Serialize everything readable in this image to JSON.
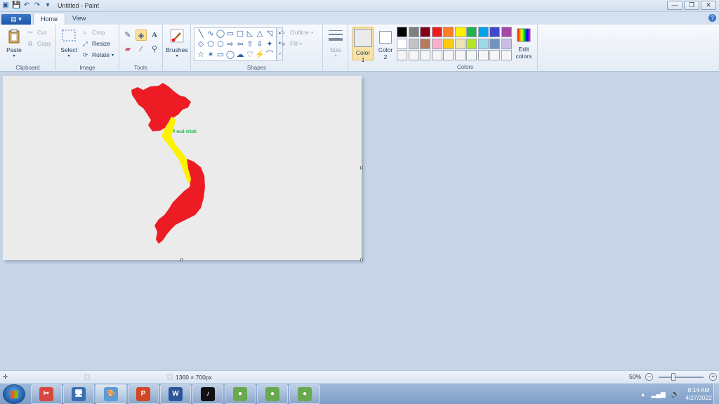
{
  "window": {
    "title": "Untitled - Paint",
    "minimize_glyph": "—",
    "restore_glyph": "❐",
    "close_glyph": "✕"
  },
  "tabs": {
    "file_glyph": "▤ ▾",
    "items": [
      "Home",
      "View"
    ],
    "help_glyph": "?"
  },
  "ribbon": {
    "clipboard": {
      "label": "Clipboard",
      "paste": "Paste",
      "cut": "Cut",
      "copy": "Copy"
    },
    "image": {
      "label": "Image",
      "select": "Select",
      "crop": "Crop",
      "resize": "Resize",
      "rotate": "Rotate"
    },
    "tools": {
      "label": "Tools",
      "selected_tool": "fill-icon"
    },
    "brushes": {
      "label": "Brushes"
    },
    "shapes": {
      "label": "Shapes",
      "outline": "Outline",
      "fill": "Fill",
      "glyphs": [
        "╲",
        "∿",
        "◯",
        "▭",
        "▢",
        "◺",
        "△",
        "◹",
        "◇",
        "⬠",
        "⬡",
        "⇨",
        "⇦",
        "⇧",
        "⇩",
        "✦",
        "☆",
        "✶",
        "▭",
        "◯",
        "☁",
        "♡",
        "⚡",
        "⌒"
      ]
    },
    "size": {
      "label": "Size"
    },
    "color1": {
      "label": "Color",
      "index": "1",
      "value": "#ebebeb"
    },
    "color2": {
      "label": "Color",
      "index": "2",
      "value": "#ffffff"
    },
    "colors": {
      "label": "Colors",
      "edit_label": "Edit",
      "edit_label2": "colors",
      "row1": [
        "#000000",
        "#7f7f7f",
        "#880015",
        "#ed1c24",
        "#ff7f27",
        "#fff200",
        "#22b14c",
        "#00a2e8",
        "#3f48cc",
        "#a349a4"
      ],
      "row2": [
        "#ffffff",
        "#c3c3c3",
        "#b97a57",
        "#ffaec9",
        "#ffc90e",
        "#efe4b0",
        "#b5e61d",
        "#99d9ea",
        "#7092be",
        "#c8bfe7"
      ],
      "row3": [
        "#f5f5f5",
        "#f5f5f5",
        "#f5f5f5",
        "#f5f5f5",
        "#f5f5f5",
        "#f5f5f5",
        "#f5f5f5",
        "#f5f5f5",
        "#f5f5f5",
        "#f5f5f5"
      ]
    }
  },
  "canvas": {
    "background": "#ebebeb",
    "map_red": "#ed1c24",
    "map_yellow": "#fff200",
    "watermark": "# mai-trinh",
    "watermark_color": "#22b14c"
  },
  "statusbar": {
    "image_size": "1360 × 700px",
    "zoom": "50%",
    "zoom_level": 0.5
  },
  "taskbar": {
    "apps": [
      {
        "name": "snipping-tool-icon",
        "glyph": "✂",
        "bg": "#d8473f"
      },
      {
        "name": "remote-desktop-icon",
        "glyph": "🖥",
        "bg": "#3b6db3"
      },
      {
        "name": "paint-icon",
        "glyph": "🎨",
        "bg": "#5b9bd5"
      },
      {
        "name": "powerpoint-icon",
        "glyph": "P",
        "bg": "#d24726"
      },
      {
        "name": "word-icon",
        "glyph": "W",
        "bg": "#2b579a"
      },
      {
        "name": "tiktok-icon",
        "glyph": "♪",
        "bg": "#111111"
      },
      {
        "name": "coccoc-icon-1",
        "glyph": "●",
        "bg": "#6aa84f"
      },
      {
        "name": "coccoc-icon-2",
        "glyph": "●",
        "bg": "#6aa84f"
      },
      {
        "name": "coccoc-icon-3",
        "glyph": "●",
        "bg": "#6aa84f"
      }
    ],
    "time": "8:14 AM",
    "date": "4/27/2022"
  }
}
